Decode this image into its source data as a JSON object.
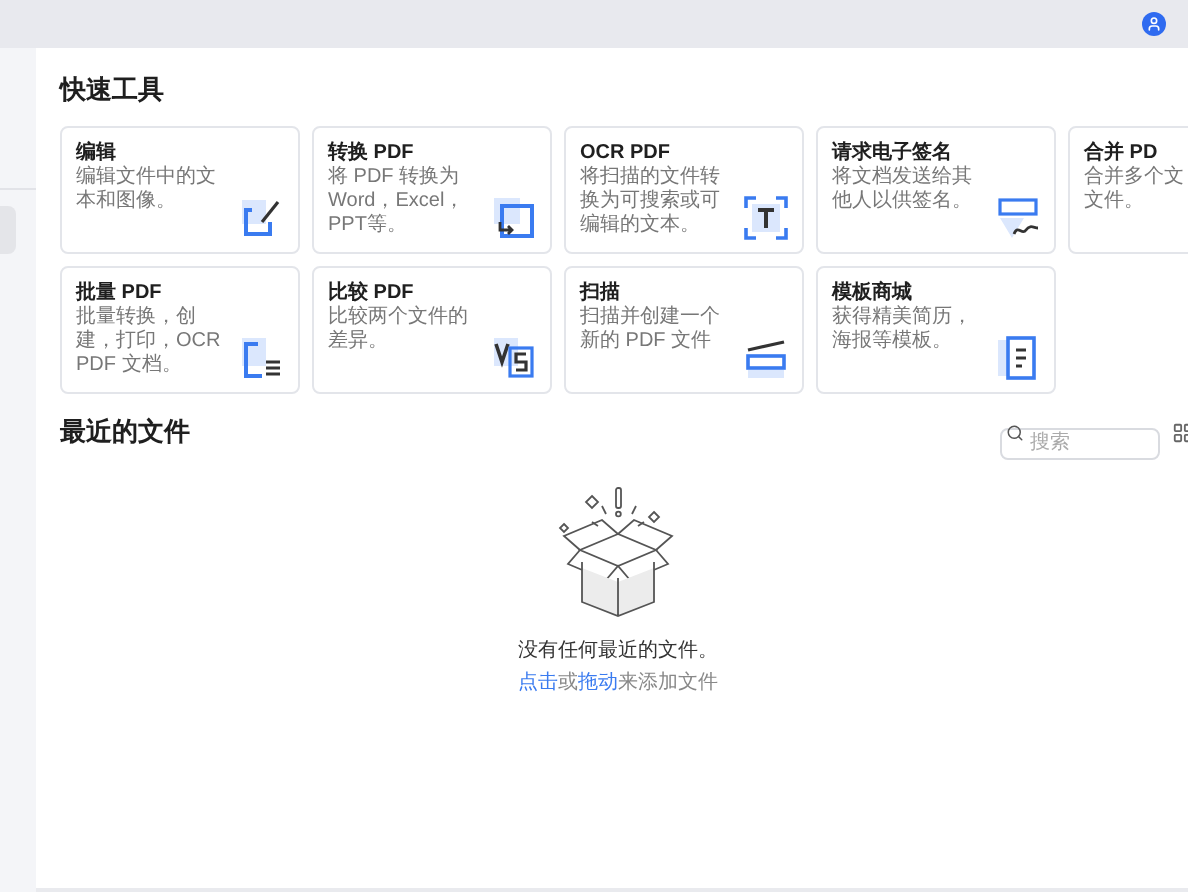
{
  "quick_tools": {
    "title": "快速工具",
    "cards": [
      {
        "kind": "edit",
        "title": "编辑",
        "description": "编辑文件中的文本和图像。"
      },
      {
        "kind": "convert",
        "title": "转换 PDF",
        "description": "将 PDF 转换为 Word，Excel，PPT等。"
      },
      {
        "kind": "ocr",
        "title": "OCR PDF",
        "description": "将扫描的文件转换为可搜索或可编辑的文本。"
      },
      {
        "kind": "sign",
        "title": "请求电子签名",
        "description": "将文档发送给其他人以供签名。"
      },
      {
        "kind": "merge",
        "title": "合并 PD",
        "description_lines": [
          "合并多个文",
          "文件。"
        ]
      },
      {
        "kind": "batch",
        "title": "批量 PDF",
        "description": "批量转换，创建，打印，OCR PDF 文档。"
      },
      {
        "kind": "compare",
        "title": "比较 PDF",
        "description": "比较两个文件的差异。"
      },
      {
        "kind": "scan",
        "title": "扫描",
        "description": "扫描并创建一个新的 PDF 文件"
      },
      {
        "kind": "template",
        "title": "模板商城",
        "description": "获得精美简历，海报等模板。"
      }
    ]
  },
  "recent_files": {
    "title": "最近的文件",
    "search": {
      "placeholder": "搜索"
    },
    "empty_state": {
      "message": "没有任何最近的文件。",
      "hint_parts": [
        {
          "kind": "link",
          "text": "点击"
        },
        {
          "kind": "text",
          "text": "或"
        },
        {
          "kind": "link",
          "text": "拖动"
        },
        {
          "kind": "text",
          "text": "来添加文件"
        }
      ]
    }
  }
}
